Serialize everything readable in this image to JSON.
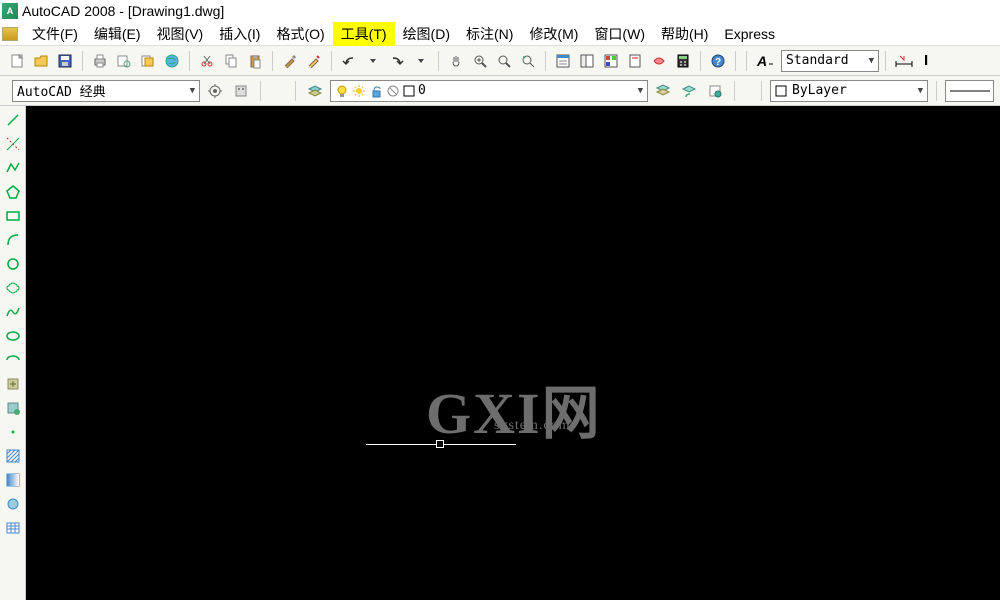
{
  "titlebar": {
    "app_title": "AutoCAD 2008 - [Drawing1.dwg]"
  },
  "menubar": {
    "items": [
      {
        "label": "文件(F)"
      },
      {
        "label": "编辑(E)"
      },
      {
        "label": "视图(V)"
      },
      {
        "label": "插入(I)"
      },
      {
        "label": "格式(O)"
      },
      {
        "label": "工具(T)",
        "highlighted": true
      },
      {
        "label": "绘图(D)"
      },
      {
        "label": "标注(N)"
      },
      {
        "label": "修改(M)"
      },
      {
        "label": "窗口(W)"
      },
      {
        "label": "帮助(H)"
      },
      {
        "label": "Express"
      }
    ]
  },
  "toolbar1": {
    "style_combo": "Standard"
  },
  "toolbar2": {
    "workspace_combo": "AutoCAD 经典",
    "layer_combo_value": "0",
    "bylayer_combo": "ByLayer"
  },
  "watermark": {
    "big": "GXI网",
    "small": "system.com"
  }
}
